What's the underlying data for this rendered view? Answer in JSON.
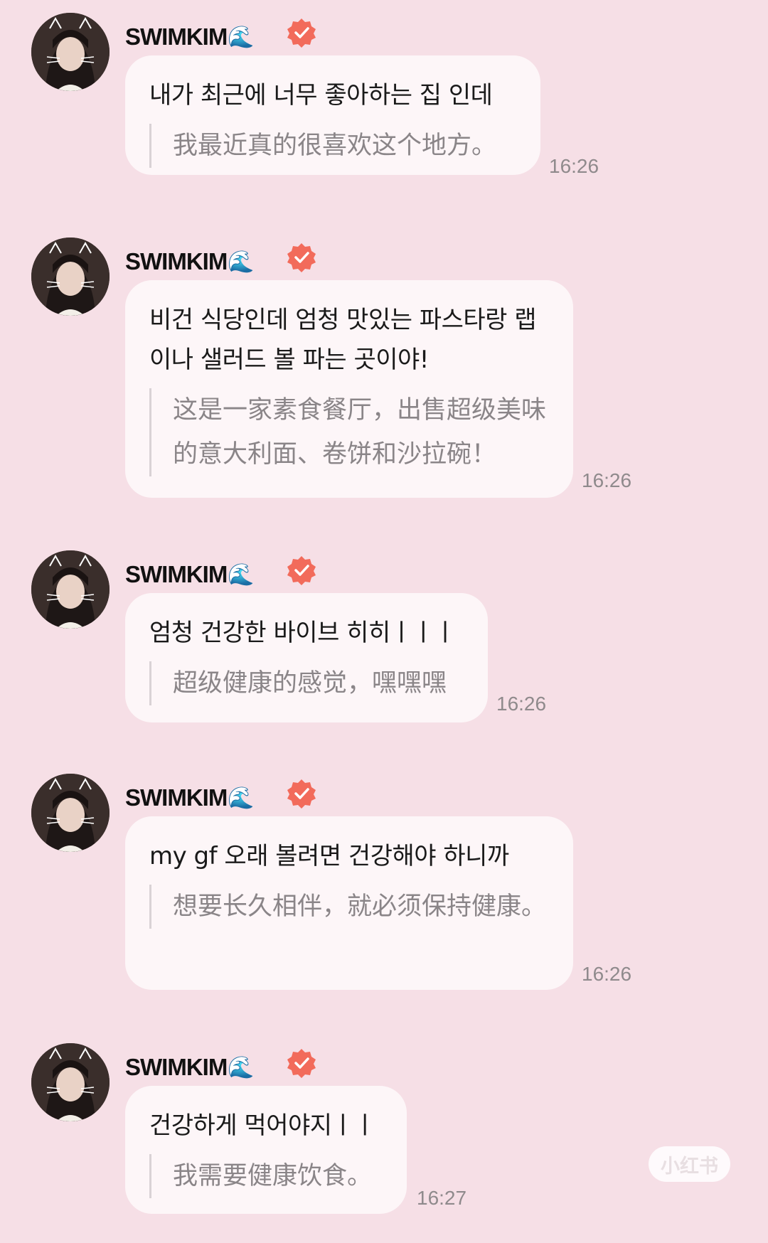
{
  "colors": {
    "background": "#f6dfe6",
    "bubble": "#fdf6f8",
    "verified": "#f26b5b"
  },
  "messages": [
    {
      "sender": "SWIMKIM",
      "emoji": "🌊",
      "text": "내가 최근에 너무 좋아하는 집 인데",
      "translation": "我最近真的很喜欢这个地方。",
      "time": "16:26"
    },
    {
      "sender": "SWIMKIM",
      "emoji": "🌊",
      "text": "비건 식당인데 엄청 맛있는 파스타랑 랩이나 샐러드 볼 파는 곳이야!",
      "translation": "这是一家素食餐厅，出售超级美味的意大利面、卷饼和沙拉碗！",
      "time": "16:26"
    },
    {
      "sender": "SWIMKIM",
      "emoji": "🌊",
      "text": "엄청 건강한 바이브 히히ㅣㅣㅣ",
      "translation": "超级健康的感觉，嘿嘿嘿",
      "time": "16:26"
    },
    {
      "sender": "SWIMKIM",
      "emoji": "🌊",
      "text": "my gf 오래 볼려면 건강해야 하니까",
      "translation": "想要长久相伴，就必须保持健康。",
      "time": "16:26"
    },
    {
      "sender": "SWIMKIM",
      "emoji": "🌊",
      "text": "건강하게 먹어야지ㅣㅣ",
      "translation": "我需要健康饮食。",
      "time": "16:27"
    }
  ],
  "watermark": "小红书"
}
